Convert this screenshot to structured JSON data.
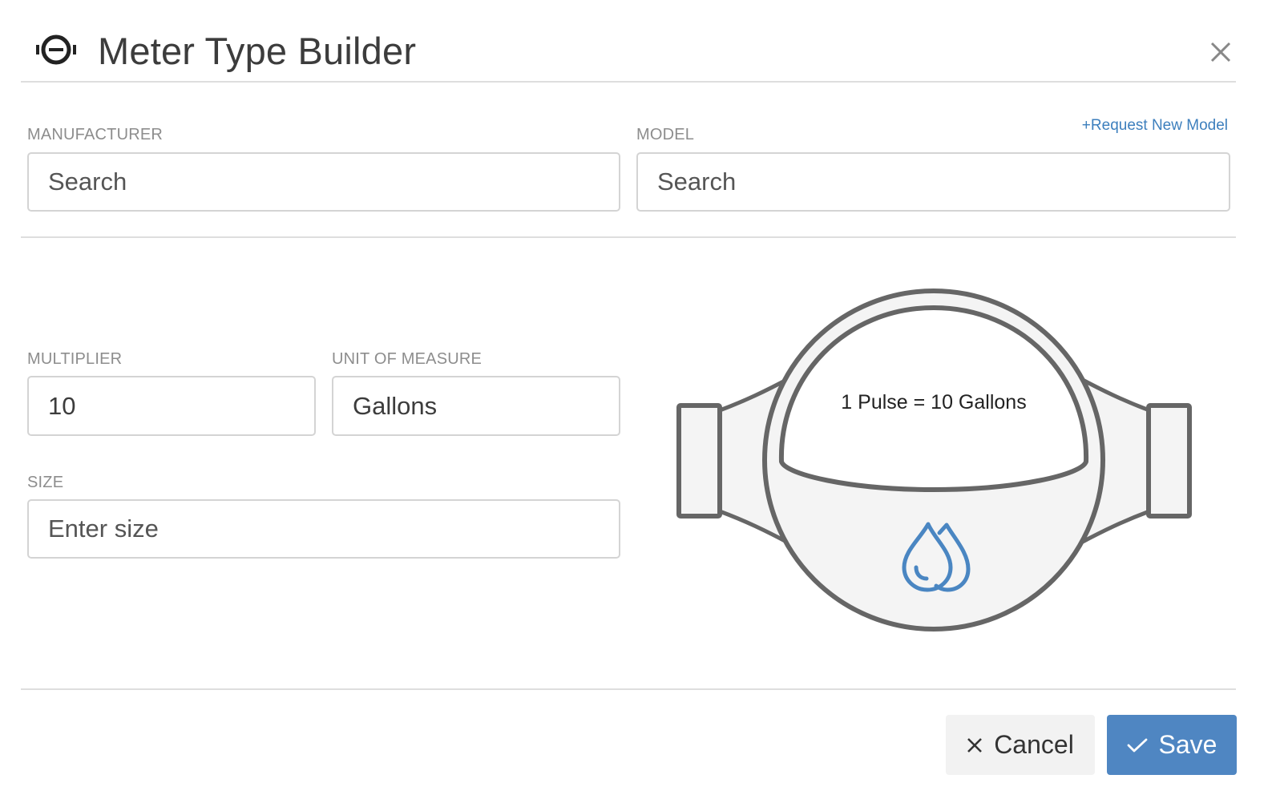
{
  "header": {
    "title": "Meter Type Builder",
    "icon": "meter-icon",
    "close_icon": "close-icon"
  },
  "manufacturer": {
    "label": "MANUFACTURER",
    "placeholder": "Search",
    "value": ""
  },
  "model": {
    "label": "MODEL",
    "placeholder": "Search",
    "value": "",
    "request_link": "Request New Model"
  },
  "multiplier": {
    "label": "MULTIPLIER",
    "value": "10"
  },
  "unit_of_measure": {
    "label": "UNIT OF MEASURE",
    "value": "Gallons"
  },
  "size": {
    "label": "SIZE",
    "placeholder": "Enter size",
    "value": ""
  },
  "meter_preview": {
    "text": "1 Pulse = 10 Gallons",
    "icon": "water-drops-icon"
  },
  "footer": {
    "cancel_label": "Cancel",
    "save_label": "Save",
    "cancel_icon": "x-icon",
    "save_icon": "check-icon"
  },
  "colors": {
    "accent": "#4f86c2",
    "link": "#3d7fbd",
    "border": "#d4d4d4",
    "divider": "#dedede",
    "label": "#8d8d8d",
    "meter_outline": "#666666",
    "meter_fill": "#f4f4f4",
    "drop": "#4a86c2"
  }
}
